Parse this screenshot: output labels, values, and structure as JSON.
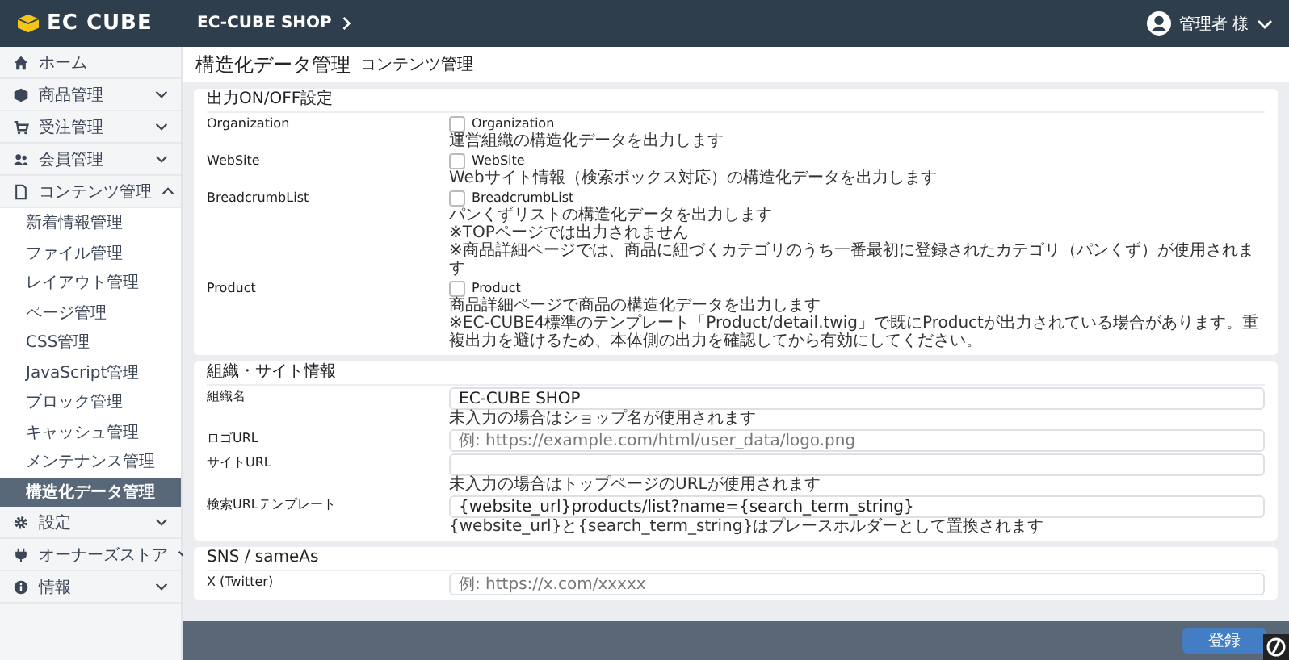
{
  "header": {
    "logo": "EC CUBE",
    "shop_name": "EC-CUBE SHOP",
    "user": "管理者 様"
  },
  "sidebar": {
    "items": [
      {
        "label": "ホーム",
        "kind": "link",
        "selected": false
      },
      {
        "label": "商品管理",
        "kind": "group",
        "expanded": false,
        "selected": false
      },
      {
        "label": "受注管理",
        "kind": "group",
        "expanded": false,
        "selected": false
      },
      {
        "label": "会員管理",
        "kind": "group",
        "expanded": false,
        "selected": false
      },
      {
        "label": "コンテンツ管理",
        "kind": "group",
        "expanded": true,
        "selected": false,
        "children": [
          {
            "label": "新着情報管理",
            "selected": false
          },
          {
            "label": "ファイル管理",
            "selected": false
          },
          {
            "label": "レイアウト管理",
            "selected": false
          },
          {
            "label": "ページ管理",
            "selected": false
          },
          {
            "label": "CSS管理",
            "selected": false
          },
          {
            "label": "JavaScript管理",
            "selected": false
          },
          {
            "label": "ブロック管理",
            "selected": false
          },
          {
            "label": "キャッシュ管理",
            "selected": false
          },
          {
            "label": "メンテナンス管理",
            "selected": false
          },
          {
            "label": "構造化データ管理",
            "selected": true
          }
        ]
      },
      {
        "label": "設定",
        "kind": "group",
        "expanded": false,
        "selected": false
      },
      {
        "label": "オーナーズストア",
        "kind": "group",
        "expanded": false,
        "selected": false
      },
      {
        "label": "情報",
        "kind": "group",
        "expanded": false,
        "selected": false
      }
    ]
  },
  "page": {
    "title": "構造化データ管理",
    "subtitle": "コンテンツ管理"
  },
  "output_card": {
    "title": "出力ON/OFF設定",
    "rows": [
      {
        "label": "Organization",
        "checkbox": "Organization",
        "checked": false,
        "notes": [
          "運営組織の構造化データを出力します"
        ]
      },
      {
        "label": "WebSite",
        "checkbox": "WebSite",
        "checked": false,
        "notes": [
          "Webサイト情報（検索ボックス対応）の構造化データを出力します"
        ]
      },
      {
        "label": "BreadcrumbList",
        "checkbox": "BreadcrumbList",
        "checked": false,
        "notes": [
          "パンくずリストの構造化データを出力します",
          "※TOPページでは出力されません",
          "※商品詳細ページでは、商品に紐づくカテゴリのうち一番最初に登録されたカテゴリ（パンくず）が使用されます"
        ]
      },
      {
        "label": "Product",
        "checkbox": "Product",
        "checked": false,
        "notes": [
          "商品詳細ページで商品の構造化データを出力します",
          "※EC-CUBE4標準のテンプレート「Product/detail.twig」で既にProductが出力されている場合があります。重複出力を避けるため、本体側の出力を確認してから有効にしてください。"
        ]
      }
    ]
  },
  "site_card": {
    "title": "組織・サイト情報",
    "fields": [
      {
        "label": "組織名",
        "value": "EC-CUBE SHOP",
        "note": "未入力の場合はショップ名が使用されます"
      },
      {
        "label": "ロゴURL",
        "placeholder": "例: https://example.com/html/user_data/logo.png"
      },
      {
        "label": "サイトURL",
        "note": "未入力の場合はトップページのURLが使用されます"
      },
      {
        "label": "検索URLテンプレート",
        "value": "{website_url}products/list?name={search_term_string}",
        "note": "{website_url}と{search_term_string}はプレースホルダーとして置換されます"
      }
    ]
  },
  "sns_card": {
    "title": "SNS / sameAs",
    "fields": [
      {
        "label": "X (Twitter)",
        "placeholder": "例: https://x.com/xxxxx"
      }
    ]
  },
  "footer": {
    "button": "登録"
  }
}
